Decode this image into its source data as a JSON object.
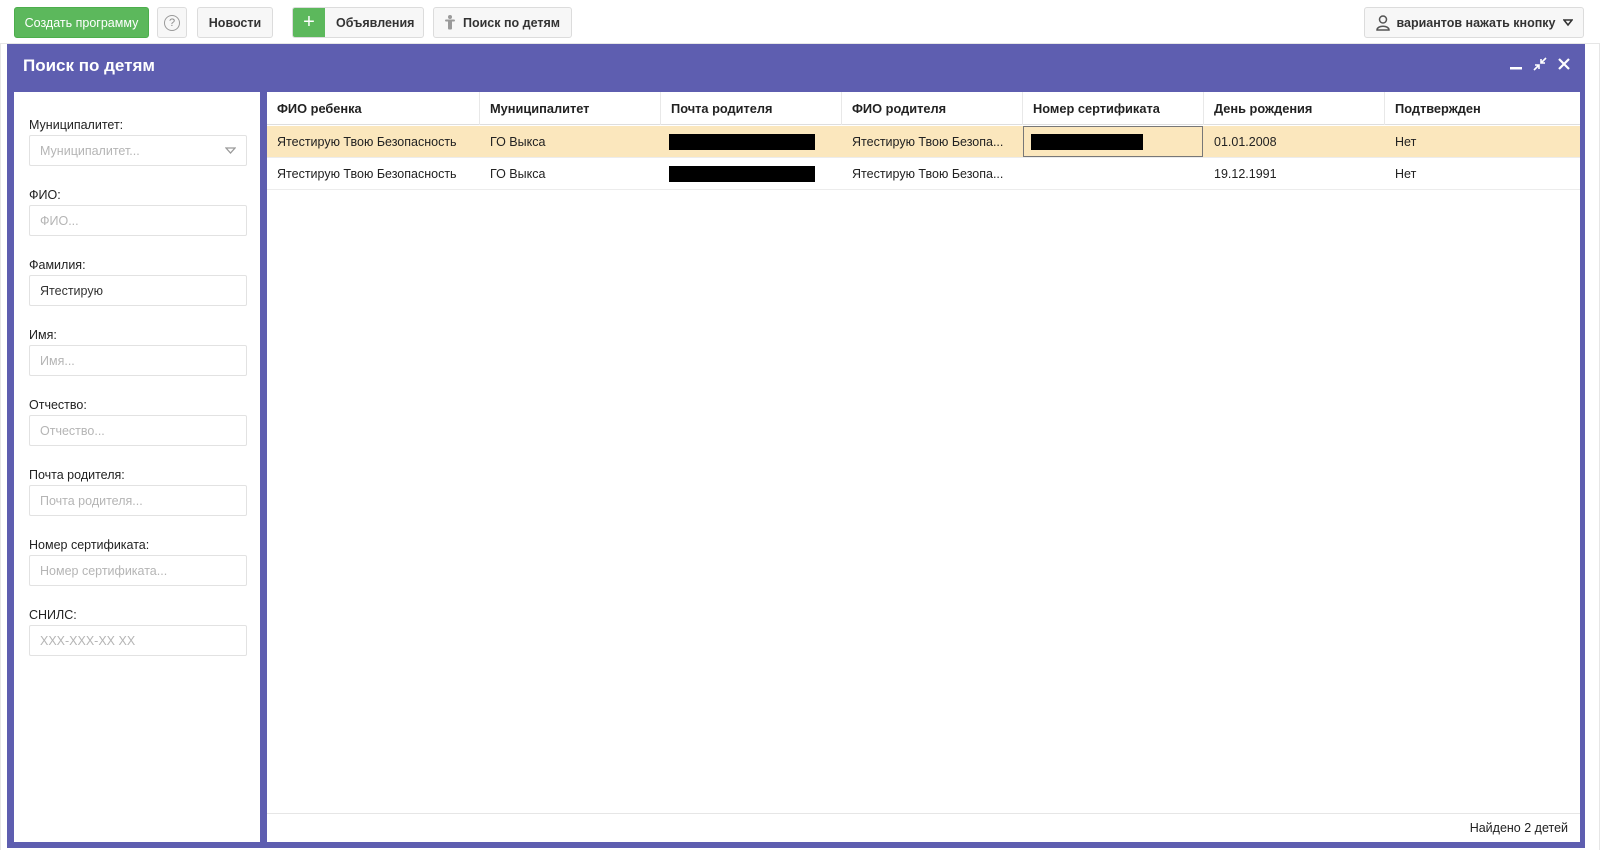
{
  "toolbar": {
    "create_label": "Создать программу",
    "help_icon": "?",
    "news_label": "Новости",
    "ads_plus": "+",
    "ads_label": "Объявления",
    "search_label": "Поиск по детям",
    "user_label": "вариантов нажать кнопку",
    "colors": {
      "green": "#5cb85c",
      "window": "#5e5eb0",
      "selected_row": "#fbe7bd"
    }
  },
  "window": {
    "title": "Поиск по детям",
    "minimize_glyph": "‒",
    "restore_glyph": "⤡",
    "close_glyph": "✕"
  },
  "filters": {
    "municipality": {
      "label": "Муниципалитет:",
      "placeholder": "Муниципалитет..."
    },
    "fio": {
      "label": "ФИО:",
      "placeholder": "ФИО..."
    },
    "surname": {
      "label": "Фамилия:",
      "value": "Ятестирую"
    },
    "name": {
      "label": "Имя:",
      "placeholder": "Имя..."
    },
    "patronymic": {
      "label": "Отчество:",
      "placeholder": "Отчество..."
    },
    "parent_email": {
      "label": "Почта родителя:",
      "placeholder": "Почта родителя..."
    },
    "certificate": {
      "label": "Номер сертификата:",
      "placeholder": "Номер сертификата..."
    },
    "snils": {
      "label": "СНИЛС:",
      "placeholder": "XXX-XXX-XX XX"
    }
  },
  "grid": {
    "columns": [
      "ФИО ребенка",
      "Муниципалитет",
      "Почта родителя",
      "ФИО родителя",
      "Номер сертификата",
      "День рождения",
      "Подтвержден"
    ],
    "rows": [
      {
        "child": "Ятестирую Твою Безопасность",
        "municipality": "ГО Выкса",
        "parent_email": "",
        "parent": "Ятестирую Твою Безопа...",
        "certificate": "",
        "birthday": "01.01.2008",
        "confirmed": "Нет"
      },
      {
        "child": "Ятестирую Твою Безопасность",
        "municipality": "ГО Выкса",
        "parent_email": "",
        "parent": "Ятестирую Твою Безопа...",
        "certificate": "",
        "birthday": "19.12.1991",
        "confirmed": "Нет"
      }
    ],
    "footer": "Найдено 2 детей"
  }
}
